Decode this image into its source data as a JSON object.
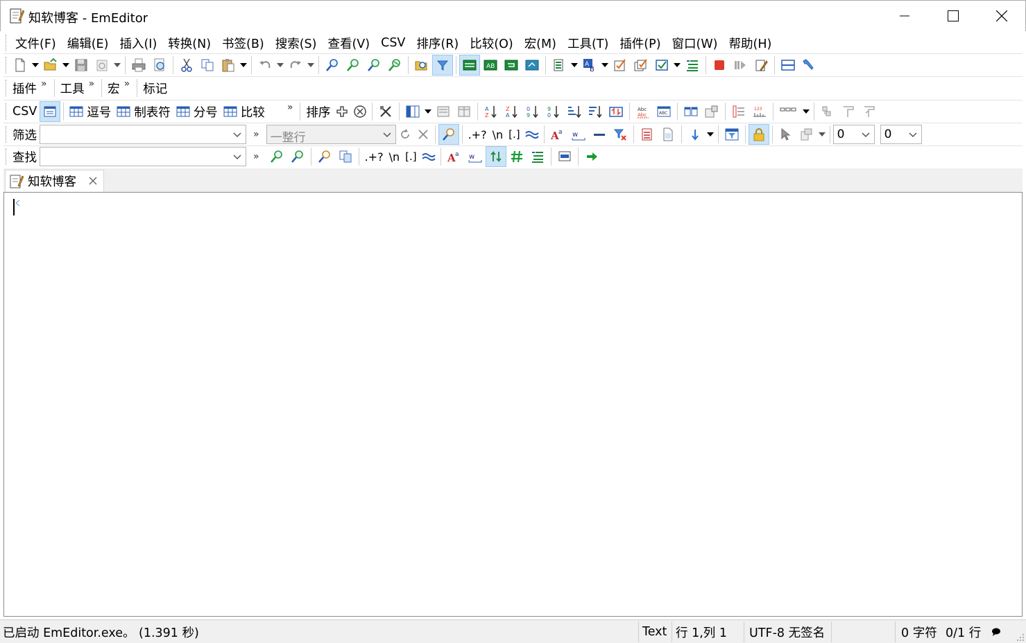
{
  "window": {
    "title": "知软博客 - EmEditor",
    "minimize_icon": "minimize-icon",
    "maximize_icon": "maximize-icon",
    "close_icon": "close-icon"
  },
  "menu": [
    {
      "label": "文件(F)"
    },
    {
      "label": "编辑(E)"
    },
    {
      "label": "插入(I)"
    },
    {
      "label": "转换(N)"
    },
    {
      "label": "书签(B)"
    },
    {
      "label": "搜索(S)"
    },
    {
      "label": "查看(V)"
    },
    {
      "label": "CSV"
    },
    {
      "label": "排序(R)"
    },
    {
      "label": "比较(O)"
    },
    {
      "label": "宏(M)"
    },
    {
      "label": "工具(T)"
    },
    {
      "label": "插件(P)"
    },
    {
      "label": "窗口(W)"
    },
    {
      "label": "帮助(H)"
    }
  ],
  "bands": {
    "plugins": "插件",
    "tools": "工具",
    "macros": "宏",
    "markers": "标记",
    "chevron": "»"
  },
  "csv_toolbar": {
    "label": "CSV",
    "comma": "逗号",
    "tab": "制表符",
    "semicolon": "分号",
    "compare": "比较",
    "sort": "排序",
    "chevron": "»"
  },
  "filter_toolbar": {
    "label": "筛选",
    "filter_value": "",
    "chevron": "»",
    "scope_value": "一整行",
    "num1_value": "0",
    "num2_value": "0"
  },
  "find_toolbar": {
    "label": "查找",
    "find_value": "",
    "chevron": "»",
    "regex_label": ".+?",
    "escape_label": "\\n",
    "bracket_label": "[.]",
    "approx_label": "≈"
  },
  "filter_extra": {
    "regex_label": ".+?",
    "escape_label": "\\n",
    "bracket_label": "[.]"
  },
  "tabs": [
    {
      "label": "知软博客"
    }
  ],
  "statusbar": {
    "message": "已启动 EmEditor.exe。 (1.391 秒)",
    "mode": "Text",
    "position": "行 1,列 1",
    "encoding": "UTF-8 无签名",
    "chars": "0 字符",
    "lines": "0/1 行"
  },
  "colors": {
    "accent": "#1e64c8",
    "toolbar_bg": "#ffffff",
    "status_bg": "#f0f0f0",
    "active_button": "#cce4f7"
  }
}
